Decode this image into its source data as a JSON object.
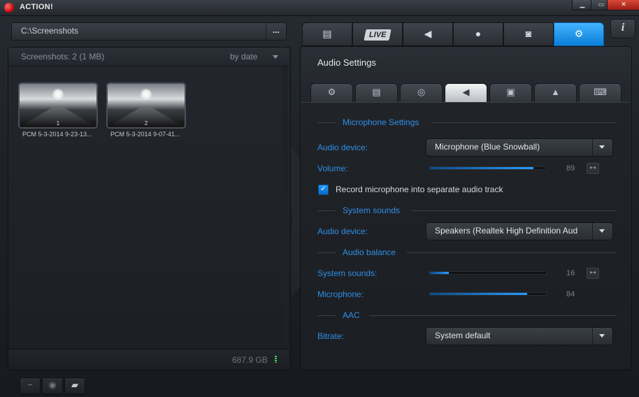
{
  "app": {
    "title": "ACTION!"
  },
  "window_controls": {
    "minimize": "▁",
    "restore": "▭",
    "close": "✕"
  },
  "path_bar": {
    "path": "C:\\Screenshots",
    "more_label": "..."
  },
  "left_panel": {
    "count_label": "Screenshots: 2 (1 MB)",
    "sort_label": "by date",
    "thumbnails": [
      {
        "number": "1",
        "caption": "PCM 5-3-2014 9-23-13..."
      },
      {
        "number": "2",
        "caption": "PCM 5-3-2014 9-07-41..."
      }
    ],
    "disk_free": "687.9 GB"
  },
  "bottom_buttons": [
    "minus-icon",
    "eye-icon",
    "folder-icon"
  ],
  "main_tabs": [
    {
      "name": "video-tab",
      "icon": "film-icon"
    },
    {
      "name": "live-tab",
      "label": "LIVE"
    },
    {
      "name": "audio-tab",
      "icon": "speaker-icon"
    },
    {
      "name": "benchmark-tab",
      "icon": "stopwatch-icon"
    },
    {
      "name": "screenshot-tab",
      "icon": "camera-icon"
    },
    {
      "name": "settings-tab",
      "icon": "gear-icon",
      "active": true
    }
  ],
  "info_label": "i",
  "settings": {
    "title": "Audio Settings",
    "subtabs": [
      "gear-icon",
      "film-icon",
      "webcam-icon",
      "speaker-icon",
      "monitor-icon",
      "upload-icon",
      "keyboard-icon"
    ],
    "active_subtab": "speaker-icon",
    "microphone_section": {
      "title": "Microphone Settings",
      "device_label": "Audio device:",
      "device_value": "Microphone (Blue Snowball)",
      "volume_label": "Volume:",
      "volume_value": "89",
      "volume_fraction": 0.89,
      "separate_track_label": "Record microphone into separate audio track",
      "separate_track_checked": true
    },
    "system_sounds_section": {
      "title": "System sounds",
      "device_label": "Audio device:",
      "device_value": "Speakers (Realtek High Definition Aud"
    },
    "balance_section": {
      "title": "Audio balance",
      "system_label": "System sounds:",
      "system_value": "16",
      "system_fraction": 0.16,
      "mic_label": "Microphone:",
      "mic_value": "84",
      "mic_fraction": 0.84
    },
    "aac_section": {
      "title": "AAC",
      "bitrate_label": "Bitrate:",
      "bitrate_value": "System default"
    }
  },
  "colors": {
    "accent": "#2f8fe6",
    "active_tab": "#1e9bff",
    "record_red": "#d10000"
  }
}
